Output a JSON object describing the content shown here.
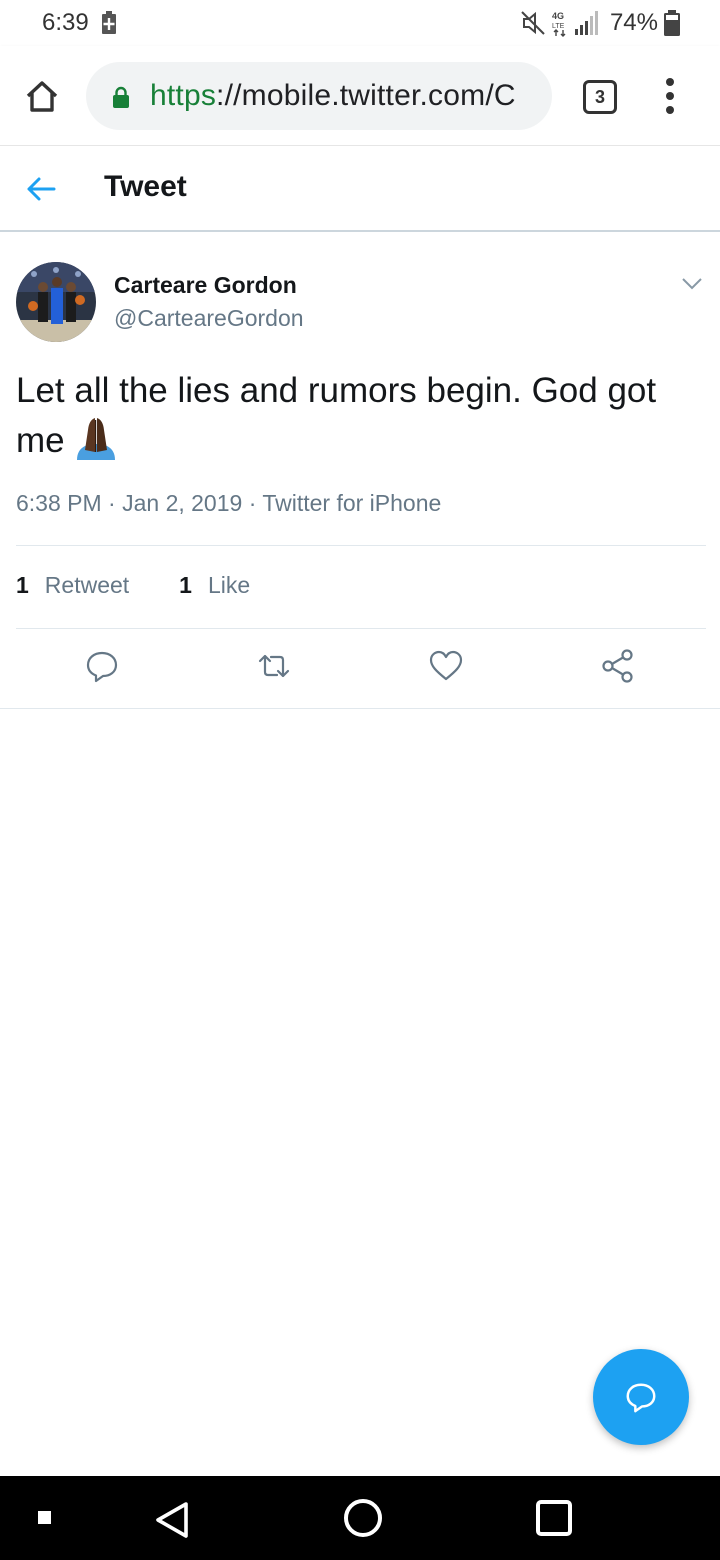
{
  "status_bar": {
    "time": "6:39",
    "battery_percent": "74%",
    "icons": [
      "battery-saver-icon",
      "mute-icon",
      "lte-icon",
      "signal-icon",
      "battery-icon"
    ]
  },
  "browser": {
    "url_scheme": "https",
    "url_rest": "://mobile.twitter.com/C",
    "tab_count": "3",
    "icons": [
      "home-icon",
      "lock-icon",
      "menu-dots-icon"
    ]
  },
  "header": {
    "title": "Tweet",
    "back_icon": "back-arrow-icon"
  },
  "tweet": {
    "author_name": "Carteare Gordon",
    "author_handle": "@CarteareGordon",
    "text": "Let all the lies and rumors begin. God got me",
    "emoji": "folded-hands-emoji",
    "timestamp": "6:38 PM · Jan 2, 2019 · Twitter for iPhone",
    "retweet_count": "1",
    "retweet_label": "Retweet",
    "like_count": "1",
    "like_label": "Like",
    "actions": [
      "reply-icon",
      "retweet-icon",
      "like-icon",
      "share-icon"
    ]
  },
  "fab": {
    "icon": "compose-reply-icon"
  },
  "colors": {
    "accent": "#1da1f2",
    "secure_green": "#188038",
    "secondary_text": "#657786",
    "primary_text": "#14171a"
  },
  "nav_bar": {
    "icons": [
      "nav-square-icon",
      "nav-back-icon",
      "nav-home-icon",
      "nav-recents-icon"
    ]
  }
}
